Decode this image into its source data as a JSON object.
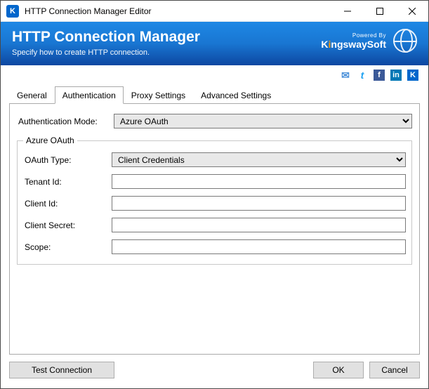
{
  "window": {
    "title": "HTTP Connection Manager Editor"
  },
  "header": {
    "title": "HTTP Connection Manager",
    "subtitle": "Specify how to create HTTP connection.",
    "brand_top": "Powered By",
    "brand_k": "K",
    "brand_i": "i",
    "brand_rest": "ngswaySoft"
  },
  "tabs": {
    "general": "General",
    "authentication": "Authentication",
    "proxy": "Proxy Settings",
    "advanced": "Advanced Settings"
  },
  "form": {
    "auth_mode_label": "Authentication Mode:",
    "auth_mode_value": "Azure OAuth",
    "group_legend": "Azure OAuth",
    "oauth_type_label": "OAuth Type:",
    "oauth_type_value": "Client Credentials",
    "tenant_id_label": "Tenant Id:",
    "tenant_id_value": "",
    "client_id_label": "Client Id:",
    "client_id_value": "",
    "client_secret_label": "Client Secret:",
    "client_secret_value": "",
    "scope_label": "Scope:",
    "scope_value": ""
  },
  "footer": {
    "test": "Test Connection",
    "ok": "OK",
    "cancel": "Cancel"
  },
  "social": {
    "mail": "✉",
    "twitter": "t",
    "facebook": "f",
    "linkedin": "in",
    "k": "K"
  }
}
